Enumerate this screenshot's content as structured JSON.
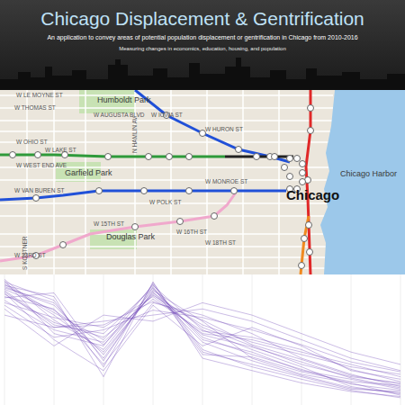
{
  "header": {
    "title": "Chicago Displacement & Gentrification",
    "subtitle": "An application to convey areas of potential population displacement or gentrification in Chicago from 2010-2016",
    "tagline": "Measuring changes in economics, education, housing, and population"
  },
  "map": {
    "labels": [
      {
        "text": "W LE MOYNE ST",
        "kind": "street"
      },
      {
        "text": "Humboldt Park",
        "kind": "place"
      },
      {
        "text": "W THOMAS ST",
        "kind": "street"
      },
      {
        "text": "W AUGUSTA BLVD",
        "kind": "street"
      },
      {
        "text": "W IOWA ST",
        "kind": "street"
      },
      {
        "text": "W HURON ST",
        "kind": "street"
      },
      {
        "text": "W OHIO ST",
        "kind": "street"
      },
      {
        "text": "W LAKE ST",
        "kind": "street"
      },
      {
        "text": "W WEST END AVE",
        "kind": "street"
      },
      {
        "text": "Garfield Park",
        "kind": "place"
      },
      {
        "text": "W MONROE ST",
        "kind": "street"
      },
      {
        "text": "Chicago Harbor",
        "kind": "place"
      },
      {
        "text": "W VAN BUREN ST",
        "kind": "street"
      },
      {
        "text": "W POLK ST",
        "kind": "street"
      },
      {
        "text": "Chicago",
        "kind": "city"
      },
      {
        "text": "W 15TH ST",
        "kind": "street"
      },
      {
        "text": "Douglas Park",
        "kind": "place"
      },
      {
        "text": "W 16TH ST",
        "kind": "street"
      },
      {
        "text": "W 18TH ST",
        "kind": "street"
      },
      {
        "text": "W 23RD ST",
        "kind": "street"
      },
      {
        "text": "N HAMLIN AV",
        "kind": "vertical"
      },
      {
        "text": "S KOSTNER",
        "kind": "vertical"
      }
    ],
    "transit_lines": [
      {
        "color": "#2050d8"
      },
      {
        "color": "#2050d8"
      },
      {
        "color": "#2e9a3a"
      },
      {
        "color": "#222222"
      },
      {
        "color": "#f0a8cc"
      },
      {
        "color": "#e02828"
      },
      {
        "color": "#f08a20"
      }
    ]
  },
  "chart": {
    "series": [
      [
        95,
        70,
        40,
        88,
        60,
        45,
        30,
        20,
        15
      ],
      [
        90,
        62,
        55,
        92,
        50,
        40,
        25,
        18,
        10
      ],
      [
        85,
        75,
        30,
        80,
        70,
        55,
        35,
        22,
        12
      ],
      [
        98,
        55,
        45,
        95,
        40,
        30,
        20,
        10,
        8
      ],
      [
        80,
        68,
        60,
        85,
        55,
        50,
        40,
        30,
        20
      ],
      [
        92,
        80,
        35,
        90,
        65,
        35,
        22,
        15,
        5
      ],
      [
        88,
        50,
        25,
        78,
        45,
        60,
        45,
        25,
        18
      ],
      [
        96,
        72,
        50,
        94,
        58,
        42,
        28,
        12,
        6
      ],
      [
        70,
        60,
        65,
        70,
        75,
        65,
        50,
        35,
        25
      ],
      [
        94,
        85,
        20,
        97,
        35,
        25,
        15,
        8,
        4
      ],
      [
        82,
        58,
        48,
        86,
        62,
        48,
        38,
        28,
        22
      ],
      [
        99,
        66,
        42,
        91,
        52,
        38,
        26,
        14,
        9
      ],
      [
        75,
        45,
        70,
        65,
        80,
        70,
        55,
        40,
        30
      ],
      [
        93,
        78,
        38,
        89,
        48,
        33,
        21,
        11,
        7
      ],
      [
        87,
        64,
        52,
        83,
        57,
        52,
        42,
        26,
        16
      ],
      [
        97,
        82,
        28,
        96,
        42,
        28,
        18,
        9,
        3
      ],
      [
        78,
        52,
        58,
        74,
        68,
        58,
        46,
        32,
        24
      ],
      [
        91,
        74,
        46,
        87,
        54,
        44,
        32,
        19,
        11
      ],
      [
        84,
        88,
        33,
        93,
        38,
        36,
        24,
        16,
        13
      ],
      [
        89,
        60,
        62,
        81,
        66,
        46,
        34,
        21,
        14
      ]
    ]
  }
}
